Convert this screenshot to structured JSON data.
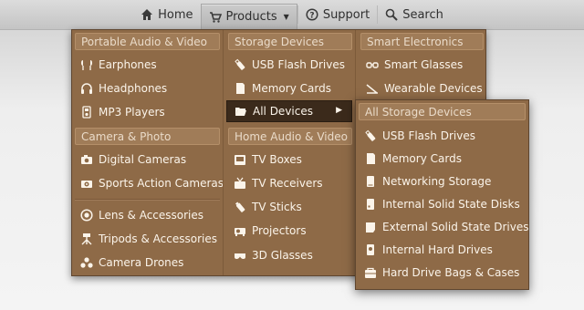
{
  "nav": {
    "home": "Home",
    "products": "Products",
    "support": "Support",
    "search": "Search"
  },
  "menu": {
    "col1": {
      "head1": "Portable Audio & Video",
      "items1": [
        "Earphones",
        "Headphones",
        "MP3 Players"
      ],
      "head2": "Camera & Photo",
      "items2": [
        "Digital Cameras",
        "Sports Action Cameras"
      ],
      "items3": [
        "Lens & Accessories",
        "Tripods & Accessories",
        "Camera Drones"
      ]
    },
    "col2": {
      "head1": "Storage Devices",
      "items1": [
        "USB Flash Drives",
        "Memory Cards",
        "All Devices"
      ],
      "head2": "Home Audio & Video",
      "items2": [
        "TV Boxes",
        "TV Receivers",
        "TV Sticks",
        "Projectors",
        "3D Glasses"
      ]
    },
    "col3": {
      "head1": "Smart Electronics",
      "items1": [
        "Smart Glasses",
        "Wearable Devices"
      ]
    },
    "submenu": {
      "head": "All Storage Devices",
      "items": [
        "USB Flash Drives",
        "Memory Cards",
        "Networking Storage",
        "Internal Solid State Disks",
        "External Solid State Drives",
        "Internal Hard Drives",
        "Hard Drive Bags & Cases"
      ]
    }
  },
  "colors": {
    "menu_bg": "#8e6a47",
    "header_bg": "#a07c58",
    "selected_bg": "#3b2a1b",
    "text": "#fbf4ea"
  }
}
